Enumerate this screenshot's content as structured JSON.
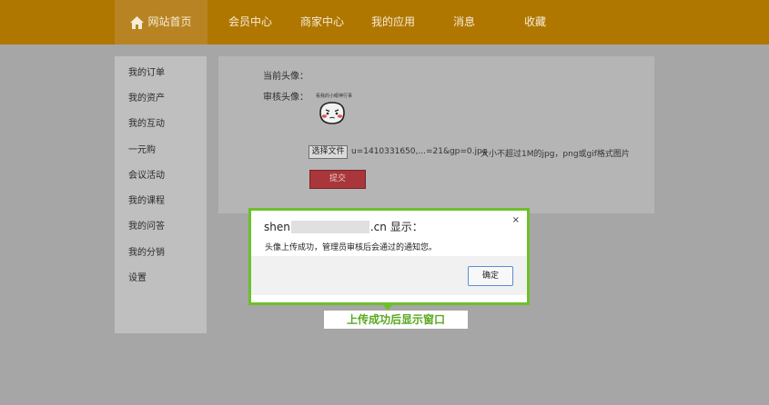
{
  "nav": {
    "home": "网站首页",
    "items": [
      "会员中心",
      "商家中心",
      "我的应用",
      "消息",
      "收藏"
    ]
  },
  "sidebar": {
    "items": [
      "我的订单",
      "我的资产",
      "我的互动",
      "一元购",
      "会议活动",
      "我的课程",
      "我的问答",
      "我的分销",
      "设置"
    ]
  },
  "profile": {
    "current_avatar_label": "当前头像：",
    "review_avatar_label": "审核头像：",
    "avatar_caption": "看我的小眼神行事",
    "choose_file_label": "选择文件",
    "file_name": "u=1410331650,...=21&gp=0.jpg",
    "file_hint": "大小不超过1M的jpg，png或gif格式图片",
    "submit_label": "提交"
  },
  "dialog": {
    "title_prefix": "shen",
    "title_suffix": ".cn 显示：",
    "close_glyph": "×",
    "message": "头像上传成功，管理员审核后会通过的通知您。",
    "ok_label": "确定"
  },
  "annotation": {
    "callout": "上传成功后显示窗口"
  },
  "colors": {
    "nav_bg": "#b07700",
    "dialog_border": "#6cc02a",
    "submit_bg": "#a8363a"
  }
}
